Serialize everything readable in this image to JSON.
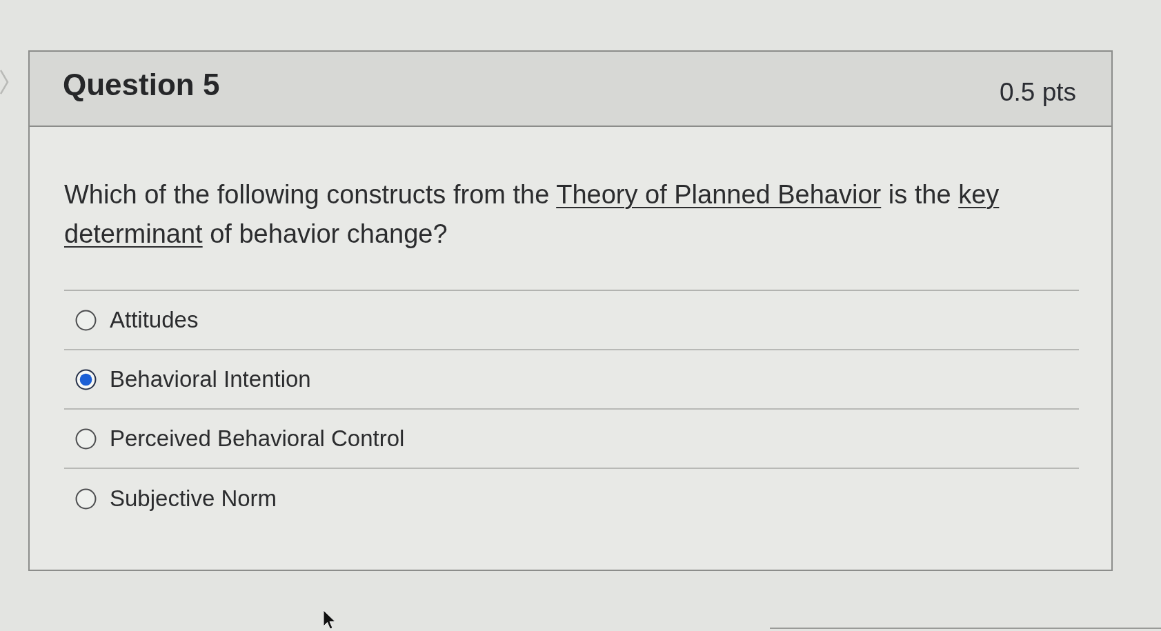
{
  "question": {
    "title": "Question 5",
    "points": "0.5 pts",
    "text": [
      {
        "kind": "plain",
        "text": "Which of the following constructs from the "
      },
      {
        "kind": "underline",
        "text": "Theory of Planned Behavior"
      },
      {
        "kind": "plain",
        "text": " is the "
      },
      {
        "kind": "underline",
        "text": "key determinant"
      },
      {
        "kind": "plain",
        "text": " of behavior change?"
      }
    ]
  },
  "answers": [
    {
      "label": "Attitudes",
      "selected": false
    },
    {
      "label": "Behavioral Intention",
      "selected": true
    },
    {
      "label": "Perceived Behavioral Control",
      "selected": false
    },
    {
      "label": "Subjective Norm",
      "selected": false
    }
  ]
}
